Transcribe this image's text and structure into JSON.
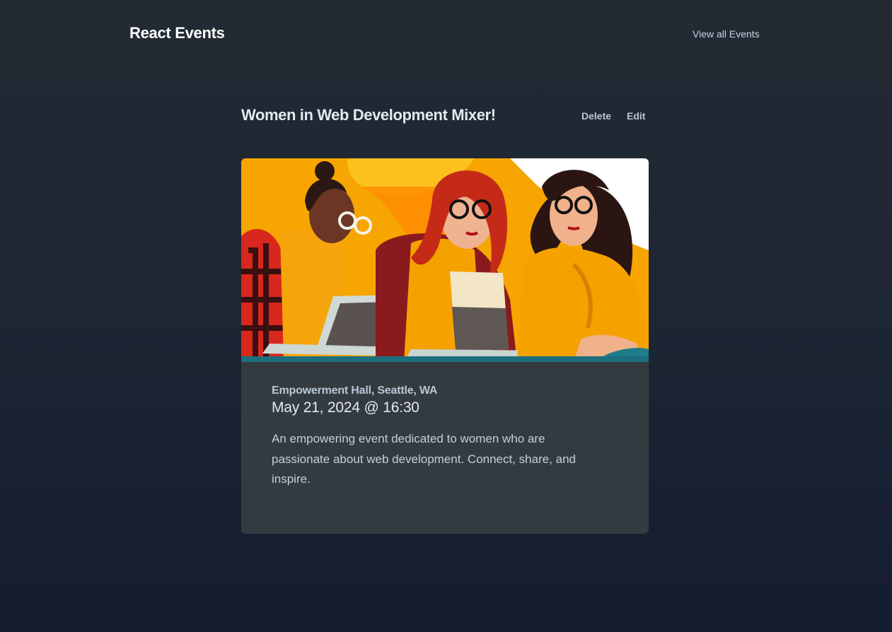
{
  "header": {
    "brand": "React Events",
    "nav_link": "View all Events"
  },
  "event": {
    "title": "Women in Web Development Mixer!",
    "actions": {
      "delete_label": "Delete",
      "edit_label": "Edit"
    },
    "location": "Empowerment Hall, Seattle, WA",
    "datetime": "May 21, 2024 @ 16:30",
    "description": "An empowering event dedicated to women who are passionate about web development. Connect, share, and inspire."
  },
  "colors": {
    "background_top": "#222a33",
    "background_bottom": "#141d30",
    "card_background": "#343b40",
    "image_accent": "#f8a800"
  },
  "icons": {
    "event_image": "illustration-three-women-with-laptops"
  }
}
